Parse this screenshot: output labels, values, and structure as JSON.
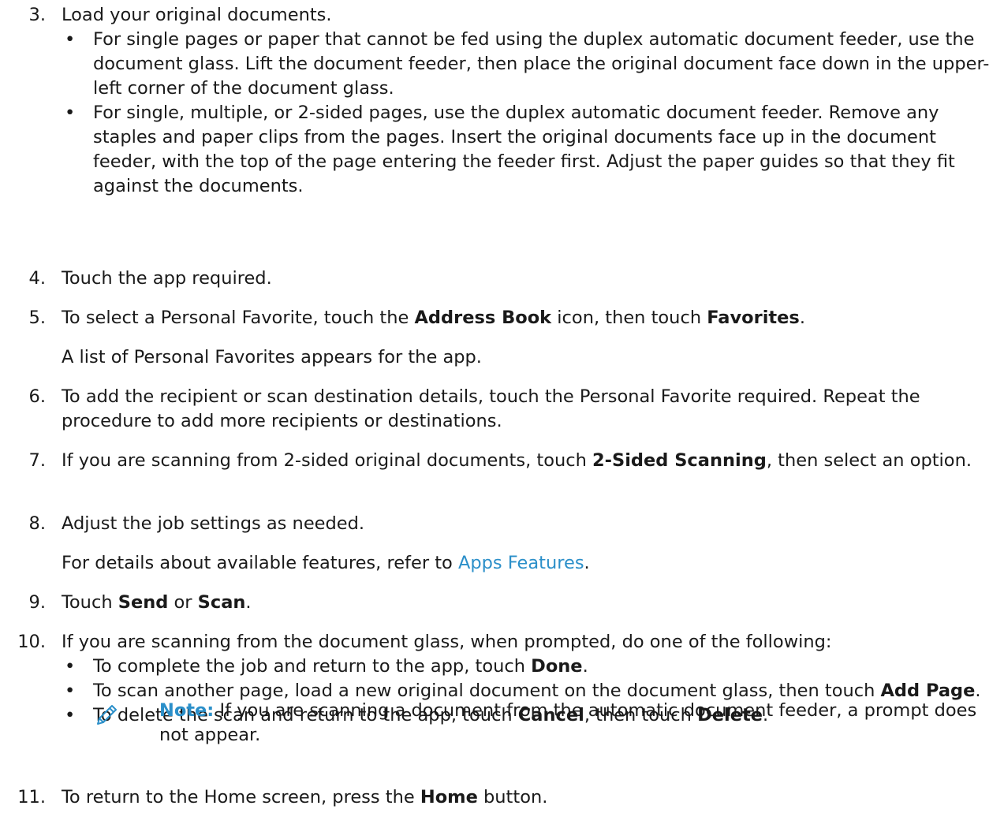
{
  "steps": {
    "s3": {
      "num": "3.",
      "text": "Load your original documents.",
      "b1": "For single pages or paper that cannot be fed using the duplex automatic document feeder, use the document glass. Lift the document feeder, then place the original document face down in the upper-left corner of the document glass.",
      "b2": "For single, multiple, or 2-sided pages, use the duplex automatic document feeder. Remove any staples and paper clips from the pages. Insert the original documents face up in the document feeder, with the top of the page entering the feeder first. Adjust the paper guides so that they fit against the documents."
    },
    "s4": {
      "num": "4.",
      "text": "Touch the app required."
    },
    "s5": {
      "num": "5.",
      "t1": "To select a Personal Favorite, touch the ",
      "bold1": "Address Book",
      "t2": " icon, then touch ",
      "bold2": "Favorites",
      "t3": ".",
      "para": "A list of Personal Favorites appears for the app."
    },
    "s6": {
      "num": "6.",
      "text": "To add the recipient or scan destination details, touch the Personal Favorite required. Repeat the procedure to add more recipients or destinations."
    },
    "s7": {
      "num": "7.",
      "t1": "If you are scanning from 2-sided original documents, touch ",
      "bold1": "2-Sided Scanning",
      "t2": ", then select an option."
    },
    "s8": {
      "num": "8.",
      "text": "Adjust the job settings as needed.",
      "para_t1": "For details about available features, refer to ",
      "para_link": "Apps Features",
      "para_t2": "."
    },
    "s9": {
      "num": "9.",
      "t1": "Touch ",
      "bold1": "Send",
      "t2": " or ",
      "bold2": "Scan",
      "t3": "."
    },
    "s10": {
      "num": "10.",
      "text": "If you are scanning from the document glass, when prompted, do one of the following:",
      "b1_t1": "To complete the job and return to the app, touch ",
      "b1_bold": "Done",
      "b1_t2": ".",
      "b2_t1": "To scan another page, load a new original document on the document glass, then touch ",
      "b2_bold": "Add Page",
      "b2_t2": ".",
      "b3_t1": "To delete the scan and return to the app, touch ",
      "b3_bold1": "Cancel",
      "b3_t2": ", then touch ",
      "b3_bold2": "Delete",
      "b3_t3": "."
    },
    "s11": {
      "num": "11.",
      "t1": "To return to the Home screen, press the ",
      "bold1": "Home",
      "t2": " button."
    }
  },
  "note": {
    "label": "Note:",
    "text": " If you are scanning a document from the automatic document feeder, a prompt does not appear.",
    "icon": "pencil-icon"
  },
  "bullet_char": "•",
  "colors": {
    "link": "#2b8fc9",
    "note_label": "#2b8fc9",
    "text": "#1a1a1a"
  }
}
